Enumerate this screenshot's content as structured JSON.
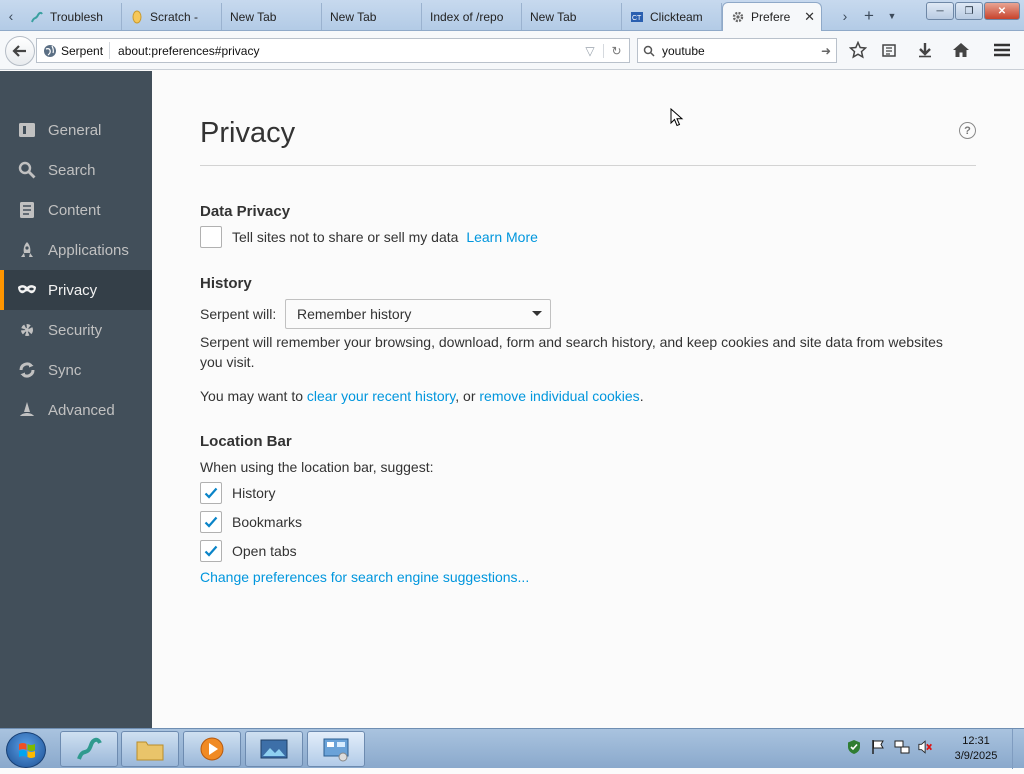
{
  "browser": {
    "tabs": [
      {
        "label": "Troublesh",
        "icon": "serpent-icon"
      },
      {
        "label": "Scratch - ",
        "icon": "scratch-icon"
      },
      {
        "label": "New Tab",
        "icon": ""
      },
      {
        "label": "New Tab",
        "icon": ""
      },
      {
        "label": "Index of /repo",
        "icon": ""
      },
      {
        "label": "New Tab",
        "icon": ""
      },
      {
        "label": "Clickteam",
        "icon": "clickteam-icon"
      },
      {
        "label": "Prefere",
        "icon": "gear-icon",
        "active": true
      }
    ],
    "new_tab_label": "+",
    "identity_label": "Serpent",
    "url": "about:preferences#privacy",
    "search_value": "youtube"
  },
  "sidebar": {
    "items": [
      {
        "label": "General",
        "icon": "general-icon"
      },
      {
        "label": "Search",
        "icon": "search-icon"
      },
      {
        "label": "Content",
        "icon": "content-icon"
      },
      {
        "label": "Applications",
        "icon": "applications-icon"
      },
      {
        "label": "Privacy",
        "icon": "privacy-mask-icon",
        "selected": true
      },
      {
        "label": "Security",
        "icon": "security-icon"
      },
      {
        "label": "Sync",
        "icon": "sync-icon"
      },
      {
        "label": "Advanced",
        "icon": "advanced-icon"
      }
    ]
  },
  "main": {
    "title": "Privacy",
    "help_glyph": "?",
    "data_privacy": {
      "heading": "Data Privacy",
      "checkbox_label": "Tell sites not to share or sell my data",
      "checked": false,
      "learn_more": "Learn More"
    },
    "history": {
      "heading": "History",
      "will_label": "Serpent will:",
      "select_value": "Remember history",
      "description": "Serpent will remember your browsing, download, form and search history, and keep cookies and site data from websites you visit.",
      "may_prefix": "You may want to",
      "clear_link": "clear your recent history",
      "or_text": ", or",
      "remove_link": "remove individual cookies",
      "period": "."
    },
    "location_bar": {
      "heading": "Location Bar",
      "intro": "When using the location bar, suggest:",
      "options": [
        {
          "label": "History",
          "checked": true
        },
        {
          "label": "Bookmarks",
          "checked": true
        },
        {
          "label": "Open tabs",
          "checked": true
        }
      ],
      "suggestions_link": "Change preferences for search engine suggestions..."
    }
  },
  "taskbar": {
    "time": "12:31",
    "date": "3/9/2025"
  },
  "colors": {
    "accent": "#ff9500",
    "link": "#0096dd",
    "sidebar": "#424f5a",
    "sidebar_selected": "#343f48"
  }
}
